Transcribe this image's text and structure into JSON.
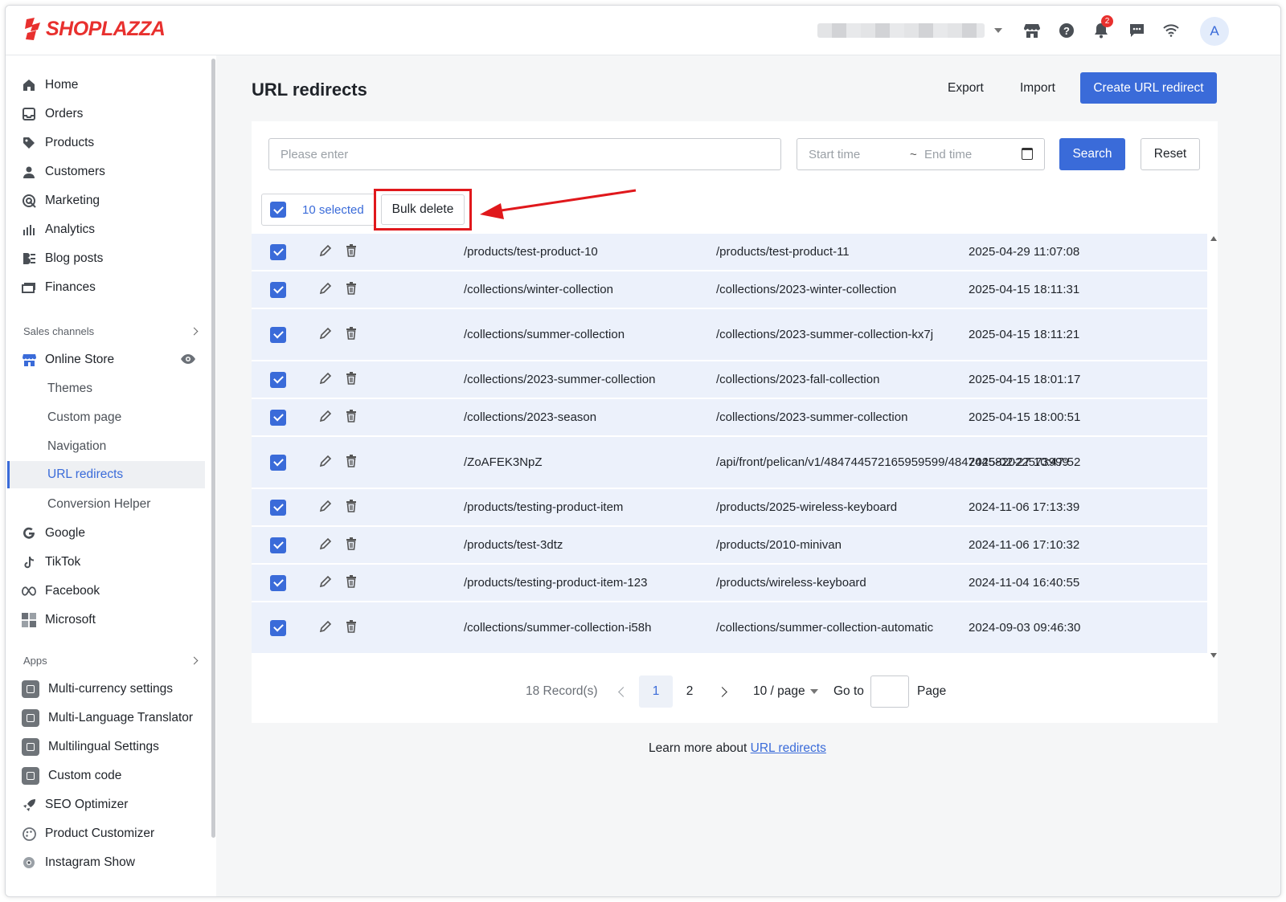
{
  "brand": {
    "name": "SHOPLAZZA",
    "color": "#e8302e"
  },
  "header": {
    "notifications_count": "2",
    "avatar_initial": "A"
  },
  "sidebar": {
    "main_items": [
      {
        "label": "Home",
        "icon": "home-icon"
      },
      {
        "label": "Orders",
        "icon": "inbox-icon"
      },
      {
        "label": "Products",
        "icon": "tag-icon"
      },
      {
        "label": "Customers",
        "icon": "user-icon"
      },
      {
        "label": "Marketing",
        "icon": "target-icon"
      },
      {
        "label": "Analytics",
        "icon": "bar-chart-icon"
      },
      {
        "label": "Blog posts",
        "icon": "blog-icon"
      },
      {
        "label": "Finances",
        "icon": "finance-icon"
      }
    ],
    "sales_channels_label": "Sales channels",
    "online_store_label": "Online Store",
    "online_store_sub": [
      "Themes",
      "Custom page",
      "Navigation",
      "URL redirects",
      "Conversion Helper"
    ],
    "channels": [
      "Google",
      "TikTok",
      "Facebook",
      "Microsoft"
    ],
    "apps_label": "Apps",
    "apps": [
      "Multi-currency settings",
      "Multi-Language Translator",
      "Multilingual Settings",
      "Custom code",
      "SEO Optimizer",
      "Product Customizer",
      "Instagram Show"
    ]
  },
  "page": {
    "title": "URL redirects",
    "export_label": "Export",
    "import_label": "Import",
    "create_label": "Create URL redirect"
  },
  "filters": {
    "search_placeholder": "Please enter",
    "start_placeholder": "Start time",
    "separator": "~",
    "end_placeholder": "End time",
    "search_label": "Search",
    "reset_label": "Reset"
  },
  "bulk": {
    "selected_text": "10 selected",
    "bulk_delete_label": "Bulk delete"
  },
  "rows": [
    {
      "from": "/products/test-product-10",
      "to": "/products/test-product-11",
      "time": "2025-04-29 11:07:08"
    },
    {
      "from": "/collections/winter-collection",
      "to": "/collections/2023-winter-collection",
      "time": "2025-04-15 18:11:31"
    },
    {
      "from": "/collections/summer-collection",
      "to": "/collections/2023-summer-collection-kx7j",
      "time": "2025-04-15 18:11:21"
    },
    {
      "from": "/collections/2023-summer-collection",
      "to": "/collections/2023-fall-collection",
      "time": "2025-04-15 18:01:17"
    },
    {
      "from": "/collections/2023-season",
      "to": "/collections/2023-summer-collection",
      "time": "2025-04-15 18:00:51"
    },
    {
      "from": "/ZoAFEK3NpZ",
      "to": "/api/front/pelican/v1/484744572165959599/484744582022573999",
      "time": "2025-02-27 10:47:52"
    },
    {
      "from": "/products/testing-product-item",
      "to": "/products/2025-wireless-keyboard",
      "time": "2024-11-06 17:13:39"
    },
    {
      "from": "/products/test-3dtz",
      "to": "/products/2010-minivan",
      "time": "2024-11-06 17:10:32"
    },
    {
      "from": "/products/testing-product-item-123",
      "to": "/products/wireless-keyboard",
      "time": "2024-11-04 16:40:55"
    },
    {
      "from": "/collections/summer-collection-i58h",
      "to": "/collections/summer-collection-automatic",
      "time": "2024-09-03 09:46:30"
    }
  ],
  "pagination": {
    "records": "18 Record(s)",
    "pages": [
      "1",
      "2"
    ],
    "current_page": "1",
    "per_page": "10 / page",
    "goto_label": "Go to",
    "page_label": "Page"
  },
  "footer": {
    "learn_text": "Learn more about",
    "learn_link": "URL redirects"
  },
  "colors": {
    "accent": "#3a6bd9",
    "highlight": "#e0181c",
    "row_bg": "#ecf1fb"
  }
}
